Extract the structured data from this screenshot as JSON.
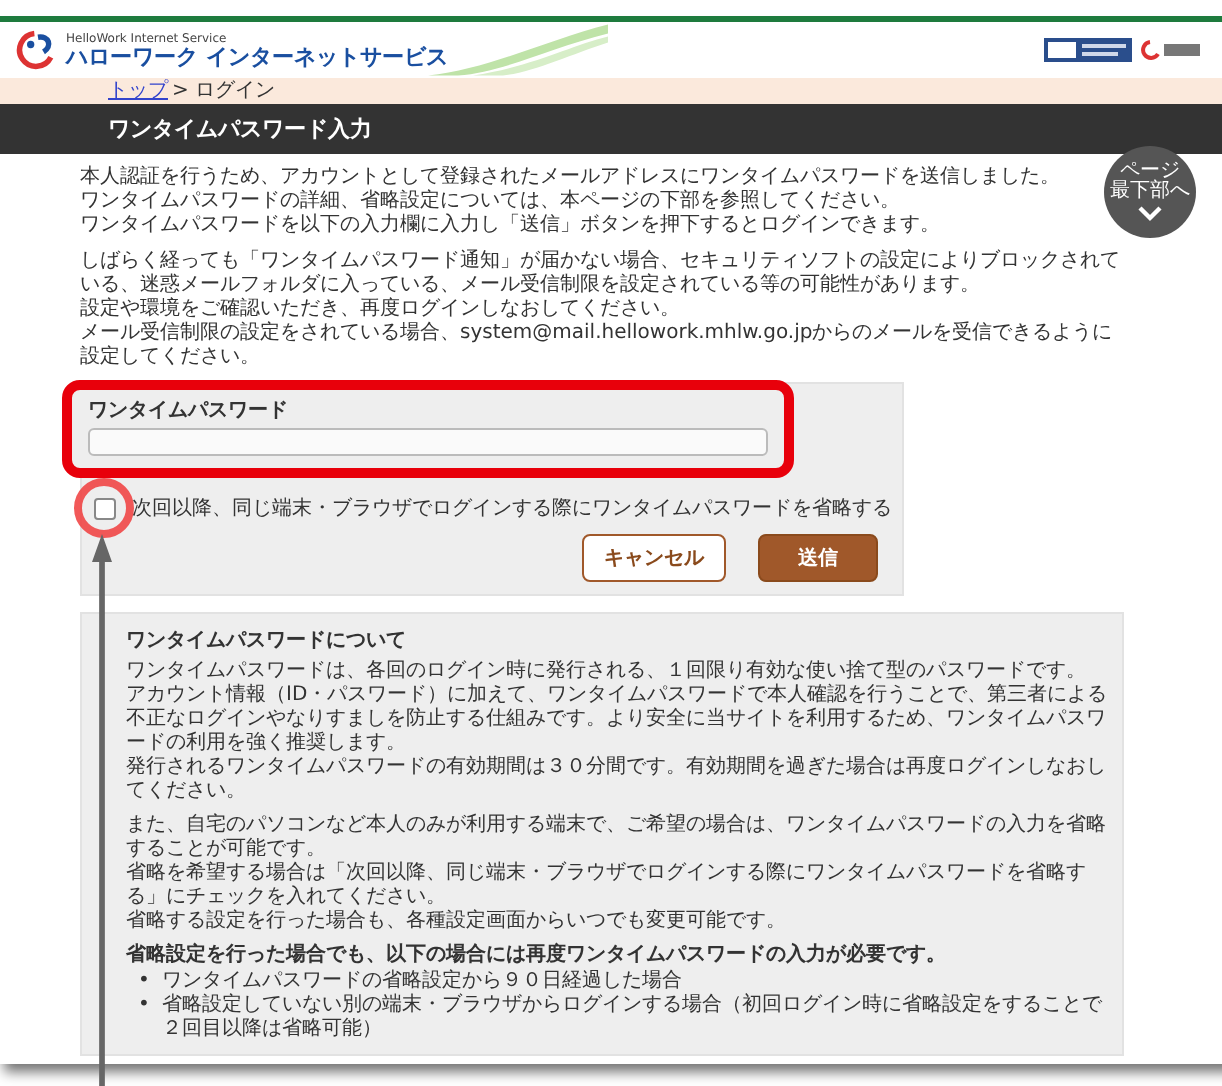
{
  "header": {
    "service_name": "HelloWork Internet Service",
    "site_title": "ハローワーク インターネットサービス"
  },
  "page_bottom_button": {
    "lines": [
      "ページ",
      "最下部へ"
    ]
  },
  "breadcrumb": [
    {
      "label": "トップ",
      "kind": "link"
    },
    {
      "label": "> ログイン",
      "kind": "current"
    }
  ],
  "page_title": "ワンタイムパスワード入力",
  "intro": [
    [
      "本人認証を行うため、アカウントとして登録されたメールアドレスにワンタイムパスワードを送信しました。",
      "ワンタイムパスワードの詳細、省略設定については、本ページの下部を参照してください。",
      "ワンタイムパスワードを以下の入力欄に入力し「送信」ボタンを押下するとログインできます。"
    ],
    [
      "しばらく経っても「ワンタイムパスワード通知」が届かない場合、セキュリティソフトの設定によりブロックされている、迷惑メールフォルダに入っている、メール受信制限を設定されている等の可能性があります。",
      "設定や環境をご確認いただき、再度ログインしなおしてください。",
      "メール受信制限の設定をされている場合、system@mail.hellowork.mhlw.go.jpからのメールを受信できるように設定してください。"
    ]
  ],
  "form": {
    "label": "ワンタイムパスワード",
    "checkbox": {
      "label": "次回以降、同じ端末・ブラウザでログインする際にワンタイムパスワードを省略する",
      "checked": false
    },
    "buttons": [
      {
        "label": "キャンセル",
        "kind": "secondary"
      },
      {
        "label": "送信",
        "kind": "primary"
      }
    ]
  },
  "info": {
    "title": "ワンタイムパスワードについて",
    "paragraphs": [
      [
        "ワンタイムパスワードは、各回のログイン時に発行される、１回限り有効な使い捨て型のパスワードです。",
        "アカウント情報（ID・パスワード）に加えて、ワンタイムパスワードで本人確認を行うことで、第三者による不正なログインやなりすましを防止する仕組みです。より安全に当サイトを利用するため、ワンタイムパスワードの利用を強く推奨します。",
        "発行されるワンタイムパスワードの有効期間は３０分間です。有効期間を過ぎた場合は再度ログインしなおしてください。"
      ],
      [
        "また、自宅のパソコンなど本人のみが利用する端末で、ご希望の場合は、ワンタイムパスワードの入力を省略することが可能です。",
        "省略を希望する場合は「次回以降、同じ端末・ブラウザでログインする際にワンタイムパスワードを省略する」にチェックを入れてください。",
        "省略する設定を行った場合も、各種設定画面からいつでも変更可能です。"
      ]
    ],
    "note": "省略設定を行った場合でも、以下の場合には再度ワンタイムパスワードの入力が必要です。",
    "bullets": [
      {
        "marker": "•",
        "text": "ワンタイムパスワードの省略設定から９０日経過した場合"
      },
      {
        "marker": "•",
        "text": "省略設定していない別の端末・ブラウザからログインする場合（初回ログイン時に省略設定をすることで２回目以降は省略可能）"
      }
    ]
  }
}
